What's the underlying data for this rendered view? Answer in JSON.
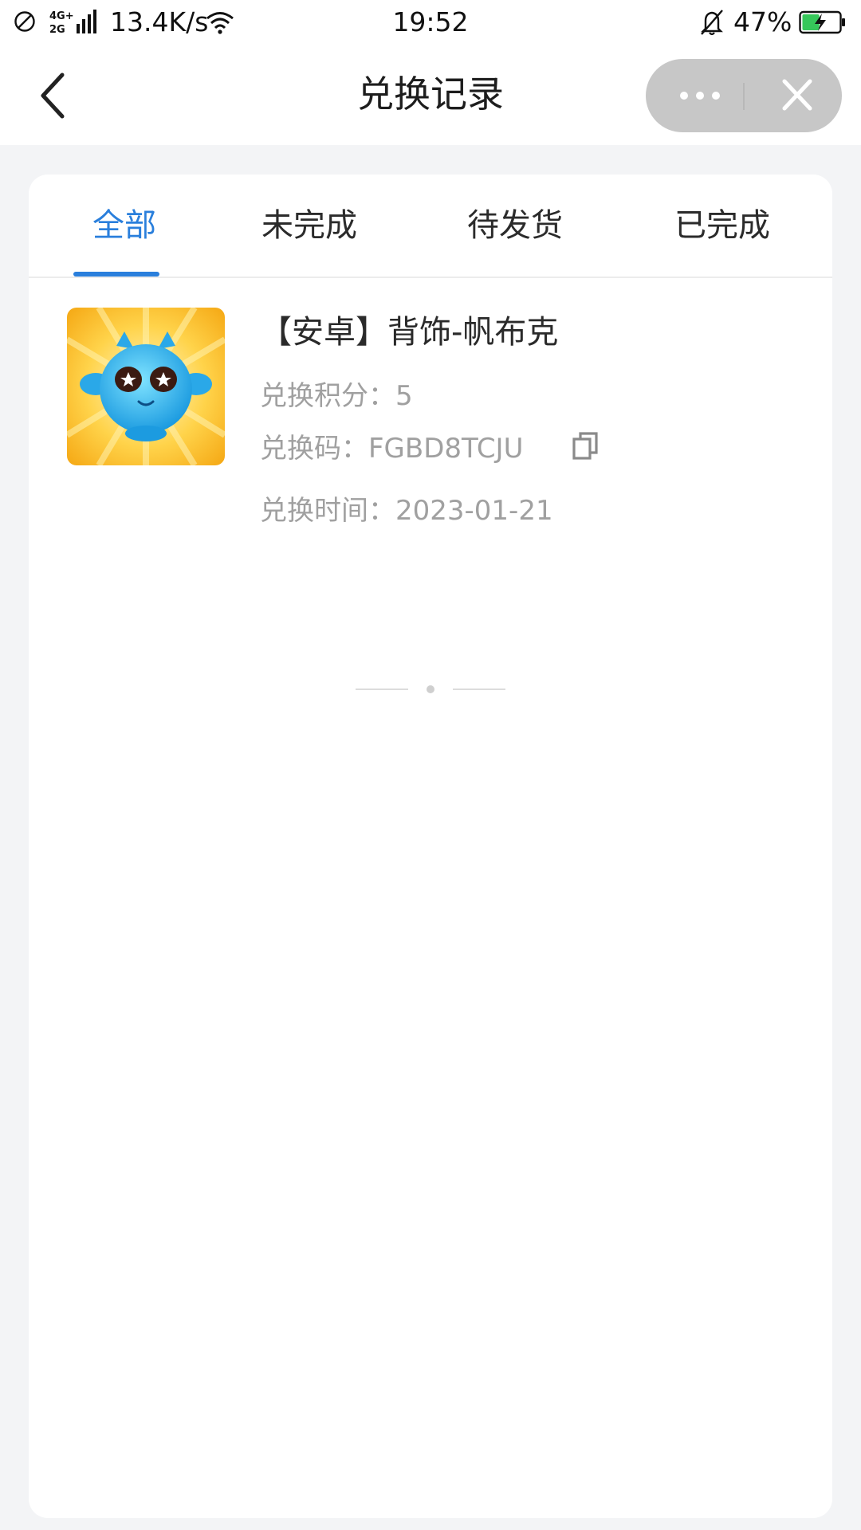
{
  "status_bar": {
    "network_label": "4G+ 2G",
    "speed": "13.4K/s",
    "time": "19:52",
    "battery_percent": "47%",
    "battery_level": 0.47,
    "battery_color": "#36c75a"
  },
  "header": {
    "title": "兑换记录"
  },
  "tabs": [
    {
      "label": "全部",
      "active": true
    },
    {
      "label": "未完成",
      "active": false
    },
    {
      "label": "待发货",
      "active": false
    },
    {
      "label": "已完成",
      "active": false
    }
  ],
  "accent_color": "#2a7fdc",
  "record": {
    "title": "【安卓】背饰-帆布克",
    "points_label": "兑换积分：",
    "points": "5",
    "code_label": "兑换码：",
    "code": "FGBD8TCJU",
    "time_label": "兑换时间：",
    "time": "2023-01-21"
  }
}
